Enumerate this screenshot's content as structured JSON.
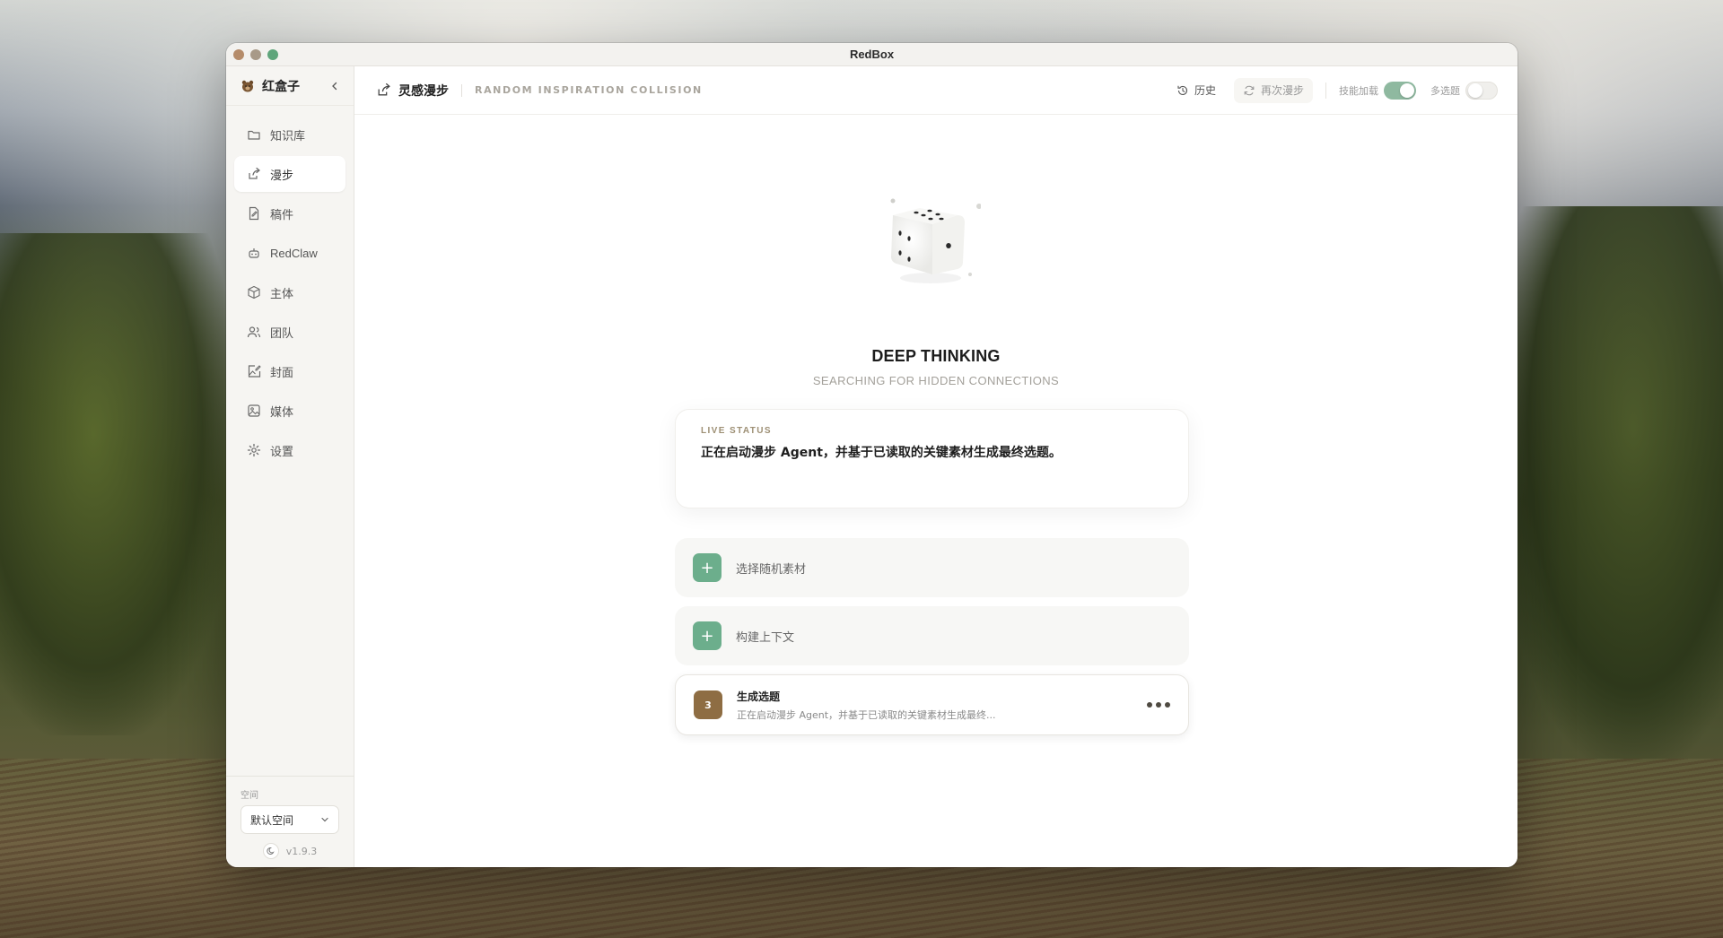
{
  "window": {
    "title": "RedBox"
  },
  "sidebar": {
    "brand": "红盒子",
    "items": [
      {
        "label": "知识库",
        "icon": "folder-icon"
      },
      {
        "label": "漫步",
        "icon": "share-arrow-icon",
        "active": true
      },
      {
        "label": "稿件",
        "icon": "document-icon"
      },
      {
        "label": "RedClaw",
        "icon": "robot-icon"
      },
      {
        "label": "主体",
        "icon": "box-icon"
      },
      {
        "label": "团队",
        "icon": "users-icon"
      },
      {
        "label": "封面",
        "icon": "image-edit-icon"
      },
      {
        "label": "媒体",
        "icon": "image-icon"
      },
      {
        "label": "设置",
        "icon": "gear-icon"
      }
    ],
    "space_caption": "空间",
    "space_value": "默认空间",
    "version": "v1.9.3"
  },
  "header": {
    "title": "灵感漫步",
    "subtitle": "RANDOM INSPIRATION COLLISION",
    "history_label": "历史",
    "rewander_label": "再次漫步",
    "skill_toggle_label": "技能加载",
    "skill_toggle_on": true,
    "multi_toggle_label": "多选题",
    "multi_toggle_on": false
  },
  "main": {
    "heading": "DEEP THINKING",
    "subheading": "SEARCHING FOR HIDDEN CONNECTIONS",
    "status_caption": "LIVE STATUS",
    "status_text": "正在启动漫步 Agent，并基于已读取的关键素材生成最终选题。",
    "steps": [
      {
        "badge": "+",
        "title": "选择随机素材",
        "state": "done"
      },
      {
        "badge": "+",
        "title": "构建上下文",
        "state": "done"
      },
      {
        "badge": "3",
        "title": "生成选题",
        "desc": "正在启动漫步 Agent，并基于已读取的关键素材生成最终...",
        "state": "active"
      }
    ]
  },
  "colors": {
    "accent_green": "#6cae8c",
    "accent_brown": "#8e6d43",
    "toggle_on": "#8fb9a0"
  }
}
